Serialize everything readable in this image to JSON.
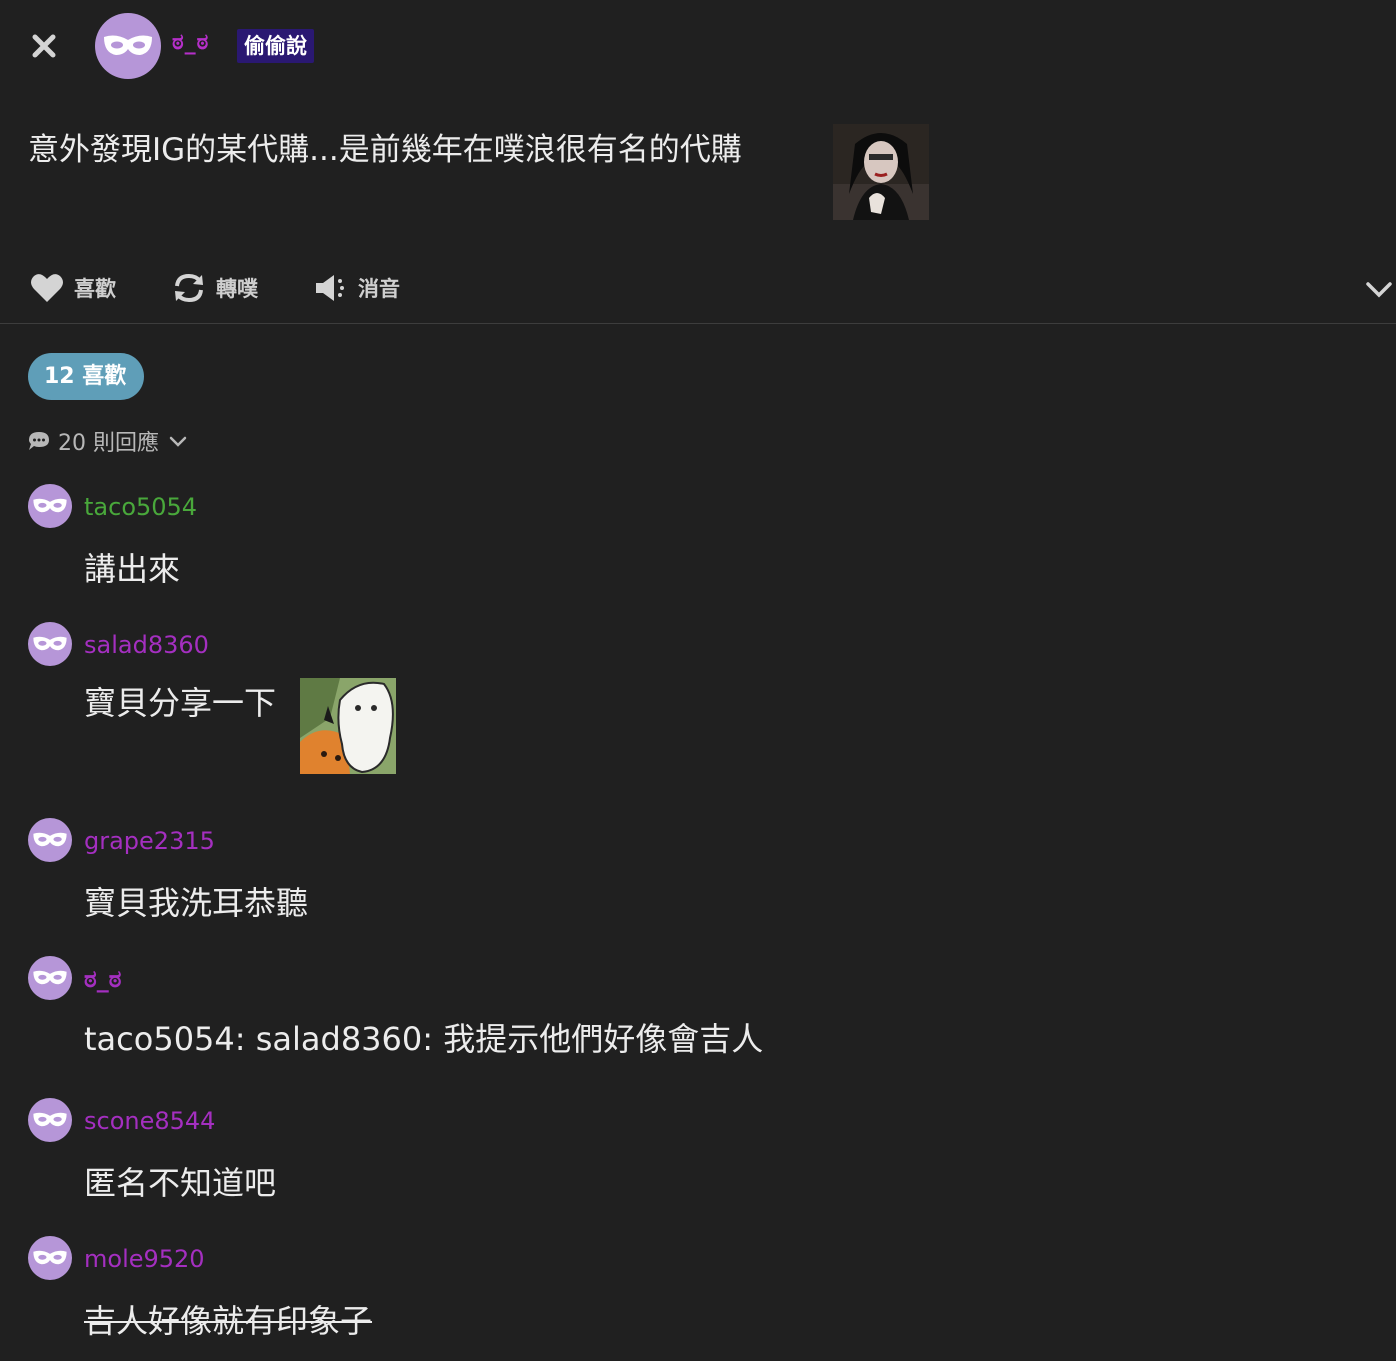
{
  "colors": {
    "background": "#202020",
    "avatar_bg": "#b696d8",
    "likes_pill_bg": "#5f9eb8",
    "badge_bg": "#2a1872"
  },
  "header": {
    "close_icon": "close-icon",
    "avatar_icon": "mask-icon",
    "poster_name": "ಠ_ಠ",
    "poster_name_color": "#b52fc9",
    "badge": "偷偷說"
  },
  "post": {
    "text": "意外發現IG的某代購...是前幾年在噗浪很有名的代購",
    "sticker": "emoticon-woman-portrait"
  },
  "actions": {
    "like_label": "喜歡",
    "like_icon": "heart-icon",
    "replurk_label": "轉噗",
    "replurk_icon": "replurk-icon",
    "mute_label": "消音",
    "mute_icon": "speaker-mute-icon",
    "expand_icon": "chevron-down-icon"
  },
  "likes": {
    "label": "12 喜歡"
  },
  "responses_header": {
    "label": "20 則回應",
    "icon": "speech-bubble-icon"
  },
  "responses": [
    {
      "name": "taco5054",
      "name_color": "#49a83b",
      "text": "講出來"
    },
    {
      "name": "salad8360",
      "name_color": "#a42fc0",
      "text": "寶貝分享一下",
      "sticker": "emoticon-ghost-and-cat"
    },
    {
      "name": "grape2315",
      "name_color": "#a42fc0",
      "text": "寶貝我洗耳恭聽"
    },
    {
      "name": "ಠ_ಠ",
      "name_color": "#a42fc0",
      "text": "taco5054: salad8360: 我提示他們好像會吉人"
    },
    {
      "name": "scone8544",
      "name_color": "#a42fc0",
      "text": "匿名不知道吧"
    },
    {
      "name": "mole9520",
      "name_color": "#a42fc0",
      "text": "吉人好像就有印象子",
      "struck": true
    }
  ]
}
